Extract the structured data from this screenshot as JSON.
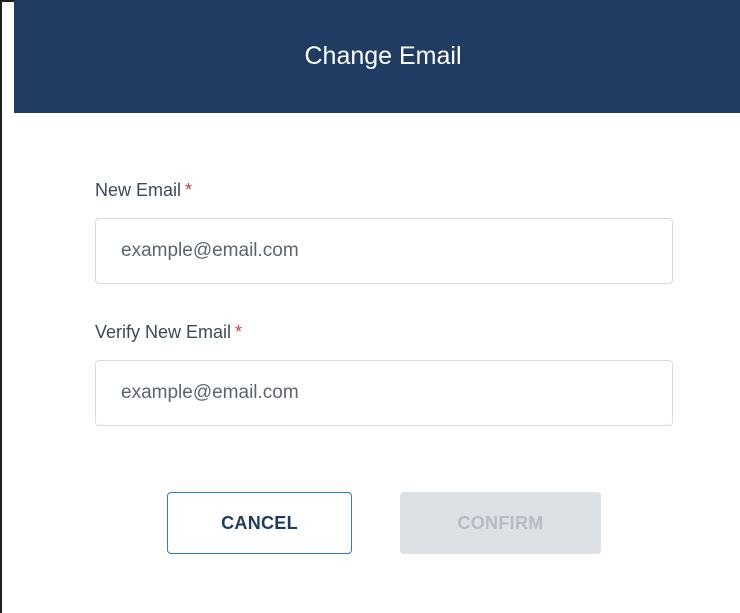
{
  "dialog": {
    "title": "Change Email"
  },
  "form": {
    "new_email": {
      "label": "New Email",
      "required_marker": "*",
      "placeholder": "example@email.com",
      "value": ""
    },
    "verify_email": {
      "label": "Verify New Email",
      "required_marker": "*",
      "placeholder": "example@email.com",
      "value": ""
    }
  },
  "actions": {
    "cancel_label": "CANCEL",
    "confirm_label": "CONFIRM",
    "confirm_disabled": true
  },
  "colors": {
    "header_bg": "#213c62",
    "accent_border": "#2c7ad6",
    "required": "#d9383a",
    "disabled_bg": "#dde0e5"
  }
}
